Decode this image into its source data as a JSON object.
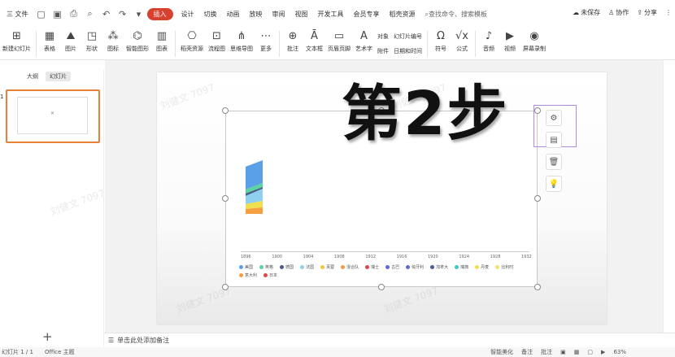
{
  "menubar": {
    "file_label": "三 文件",
    "tabs": [
      "插入",
      "设计",
      "切换",
      "动画",
      "放映",
      "审阅",
      "视图",
      "开发工具",
      "会员专享",
      "稻壳资源"
    ],
    "active_tab": "插入",
    "search_label": "查找命令、搜索模板",
    "right": {
      "unsaved": "未保存",
      "collab": "协作",
      "share": "分享"
    }
  },
  "ribbon": {
    "buttons": [
      {
        "icon": "new-slide-icon",
        "label": "新建幻灯片"
      },
      {
        "icon": "table-icon",
        "label": "表格"
      },
      {
        "icon": "picture-icon",
        "label": "图片"
      },
      {
        "icon": "shape-icon",
        "label": "形状"
      },
      {
        "icon": "icons-icon",
        "label": "图标"
      },
      {
        "icon": "smartart-icon",
        "label": "智能图形"
      },
      {
        "icon": "chart-icon",
        "label": "图表"
      },
      {
        "icon": "docer-resource-icon",
        "label": "稻壳资源"
      },
      {
        "icon": "flowchart-icon",
        "label": "流程图"
      },
      {
        "icon": "mindmap-icon",
        "label": "思维导图"
      },
      {
        "icon": "more-icon",
        "label": "更多"
      },
      {
        "icon": "comment-icon",
        "label": "批注"
      },
      {
        "icon": "textbox-icon",
        "label": "文本框"
      },
      {
        "icon": "header-footer-icon",
        "label": "页眉页脚"
      },
      {
        "icon": "wordart-icon",
        "label": "艺术字"
      }
    ],
    "small_col1": [
      "对象",
      "附件"
    ],
    "small_col2": [
      "幻灯片编号",
      "日期和时间"
    ],
    "buttons2": [
      {
        "icon": "symbol-icon",
        "label": "符号"
      },
      {
        "icon": "formula-icon",
        "label": "公式"
      },
      {
        "icon": "audio-icon",
        "label": "音频"
      },
      {
        "icon": "video-icon",
        "label": "视频"
      },
      {
        "icon": "screen-record-icon",
        "label": "屏幕录制"
      }
    ]
  },
  "leftpanel": {
    "tab_outline": "大纲",
    "tab_slides": "幻灯片",
    "slide_number": "1",
    "add_label": "+"
  },
  "slide": {
    "big_title": "第2步",
    "watermark": "刘健文 7097",
    "chart_data": {
      "type": "area",
      "x_ticks": [
        "1896",
        "1900",
        "1904",
        "1908",
        "1912",
        "1916",
        "1920",
        "1924",
        "1928",
        "1932"
      ],
      "legend": [
        {
          "name": "美国",
          "color": "#5aa0e6"
        },
        {
          "name": "英格",
          "color": "#5bd3a3"
        },
        {
          "name": "德国",
          "color": "#4a5a8a"
        },
        {
          "name": "法国",
          "color": "#8fd0f0"
        },
        {
          "name": "芙蓉",
          "color": "#f5c542"
        },
        {
          "name": "混合队",
          "color": "#f59a42"
        },
        {
          "name": "瑞士",
          "color": "#e04848"
        },
        {
          "name": "古巴",
          "color": "#5a6ad6"
        },
        {
          "name": "匈牙利",
          "color": "#5a6ad6"
        },
        {
          "name": "加拿大",
          "color": "#4a5aaa"
        },
        {
          "name": "瑞典",
          "color": "#3bc8c8"
        },
        {
          "name": "丹麦",
          "color": "#f0e050"
        },
        {
          "name": "比利时",
          "color": "#f5e070"
        },
        {
          "name": "意大利",
          "color": "#f5a040"
        },
        {
          "name": "日本",
          "color": "#e04848"
        }
      ]
    }
  },
  "notes_label": "单击此处添加备注",
  "statusbar": {
    "slide_info": "幻灯片 1 / 1",
    "theme": "Office 主题",
    "smart_beautify": "智能美化",
    "notes": "备注",
    "comment": "批注",
    "zoom": "63%"
  }
}
